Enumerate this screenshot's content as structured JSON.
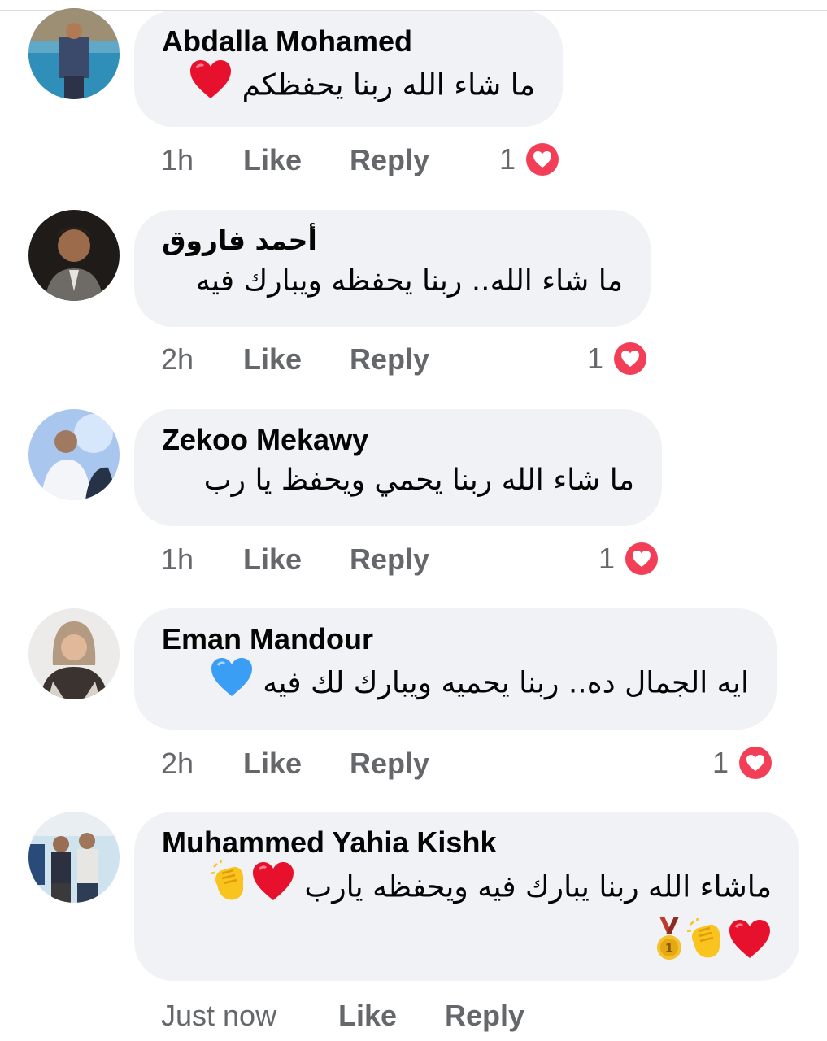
{
  "comments": [
    {
      "author": "Abdalla Mohamed",
      "text": "ما شاء الله ربنا يحفظكم",
      "emojis": [
        "red-heart"
      ],
      "time": "1h",
      "like_label": "Like",
      "reply_label": "Reply",
      "reaction_count": "1",
      "reaction": "love"
    },
    {
      "author": "أحمد فاروق",
      "text": "ما شاء الله.. ربنا يحفظه ويبارك فيه",
      "emojis": [],
      "time": "2h",
      "like_label": "Like",
      "reply_label": "Reply",
      "reaction_count": "1",
      "reaction": "love"
    },
    {
      "author": "Zekoo Mekawy",
      "text": "ما شاء الله ربنا يحمي ويحفظ يا رب",
      "emojis": [],
      "time": "1h",
      "like_label": "Like",
      "reply_label": "Reply",
      "reaction_count": "1",
      "reaction": "love"
    },
    {
      "author": "Eman Mandour",
      "text": "ايه الجمال ده.. ربنا يحميه ويبارك لك فيه",
      "emojis": [
        "blue-heart"
      ],
      "time": "2h",
      "like_label": "Like",
      "reply_label": "Reply",
      "reaction_count": "1",
      "reaction": "love"
    },
    {
      "author": "Muhammed Yahia Kishk",
      "text": "ماشاء الله ربنا يبارك فيه ويحفظه يارب",
      "text_line2": "",
      "emojis": [
        "red-heart",
        "clapping-hands",
        "red-heart",
        "clapping-hands",
        "first-place-medal"
      ],
      "time": "Just now",
      "like_label": "Like",
      "reply_label": "Reply",
      "reaction_count": "",
      "reaction": ""
    }
  ],
  "colors": {
    "bubble": "#f0f2f5",
    "meta_text": "#65676b",
    "love_reaction": "#f33e58",
    "red_heart": "#e8112d",
    "blue_heart": "#3b9ef5"
  }
}
